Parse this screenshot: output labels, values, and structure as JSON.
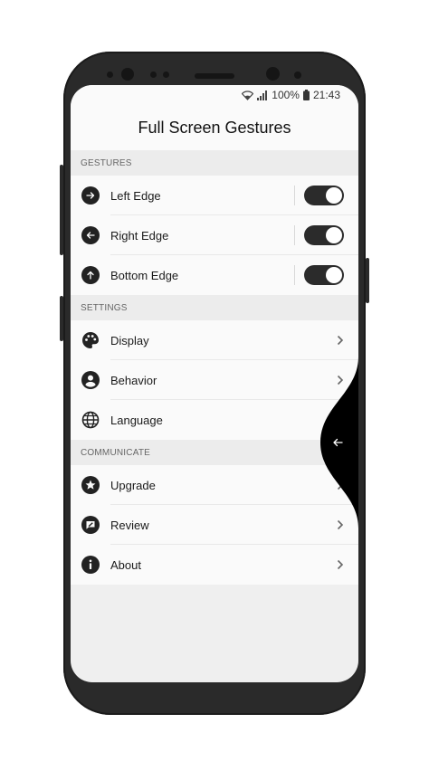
{
  "status_bar": {
    "battery": "100%",
    "time": "21:43",
    "icons": [
      "wifi-icon",
      "signal-icon",
      "battery-icon"
    ]
  },
  "app": {
    "title": "Full Screen Gestures"
  },
  "sections": {
    "gestures": {
      "header": "GESTURES",
      "items": [
        {
          "label": "Left Edge",
          "icon": "arrow-right-circle-icon",
          "enabled": true
        },
        {
          "label": "Right Edge",
          "icon": "arrow-left-circle-icon",
          "enabled": true
        },
        {
          "label": "Bottom Edge",
          "icon": "arrow-up-circle-icon",
          "enabled": true
        }
      ]
    },
    "settings": {
      "header": "SETTINGS",
      "items": [
        {
          "label": "Display",
          "icon": "palette-icon"
        },
        {
          "label": "Behavior",
          "icon": "account-circle-icon"
        },
        {
          "label": "Language",
          "icon": "globe-icon"
        }
      ]
    },
    "communicate": {
      "header": "COMMUNICATE",
      "items": [
        {
          "label": "Upgrade",
          "icon": "star-circle-icon"
        },
        {
          "label": "Review",
          "icon": "review-icon"
        },
        {
          "label": "About",
          "icon": "info-icon"
        }
      ]
    }
  },
  "colors": {
    "toggle_on": "#2b2b2b",
    "icon": "#222222",
    "section_bg": "#ececec",
    "row_bg": "#fafafa"
  }
}
